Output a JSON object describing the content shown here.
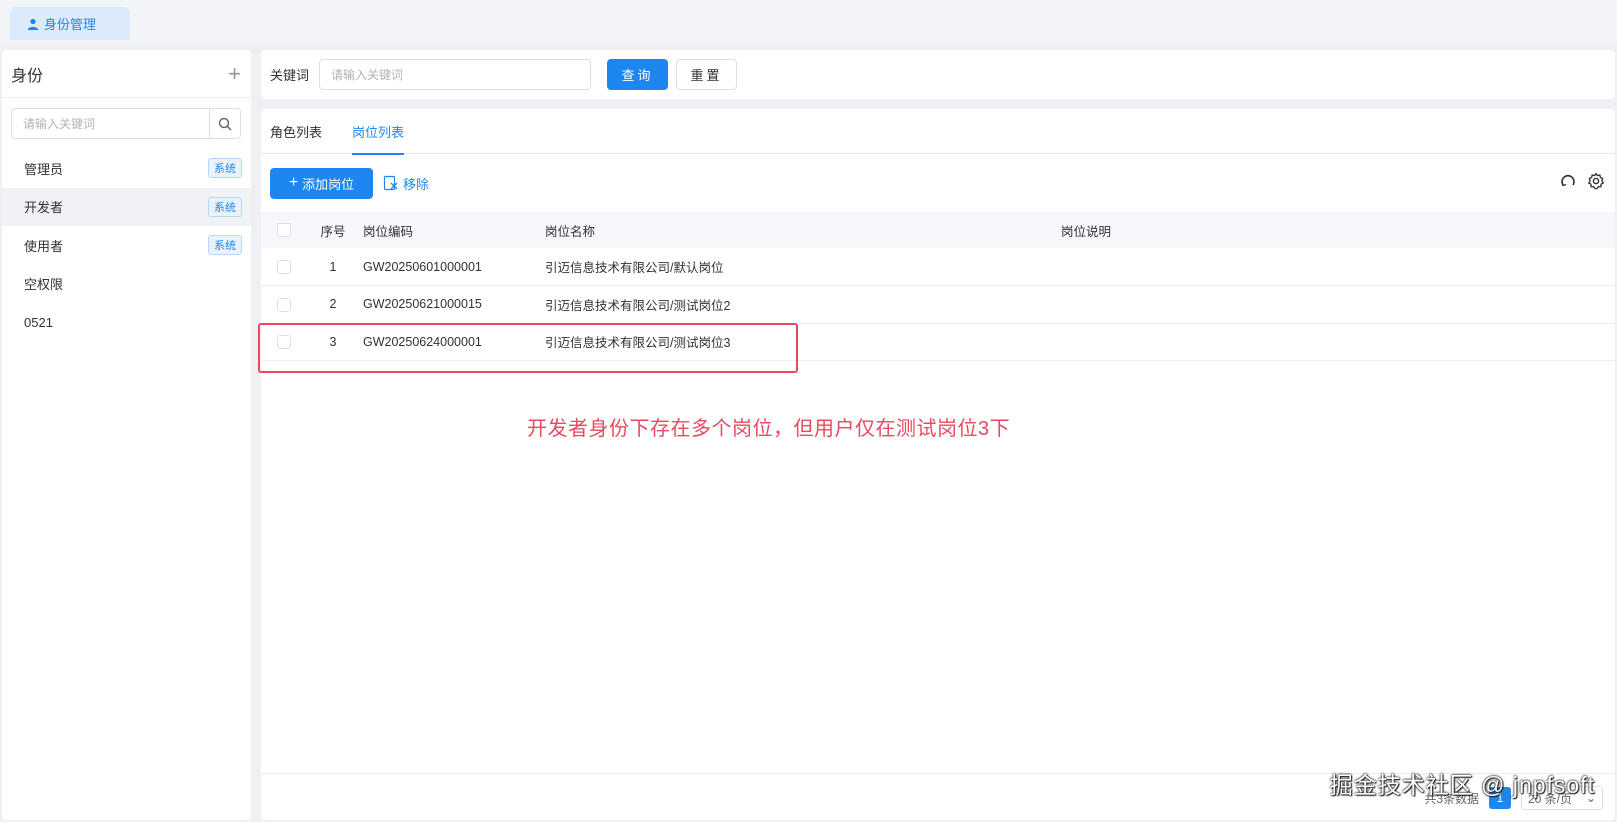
{
  "top_tab": {
    "label": "身份管理"
  },
  "sidebar": {
    "title": "身份",
    "search_placeholder": "请输入关键词",
    "items": [
      {
        "label": "管理员",
        "badge": "系统"
      },
      {
        "label": "开发者",
        "badge": "系统"
      },
      {
        "label": "使用者",
        "badge": "系统"
      },
      {
        "label": "空权限",
        "badge": ""
      },
      {
        "label": "0521",
        "badge": ""
      }
    ]
  },
  "search": {
    "label": "关键词",
    "placeholder": "请输入关键词",
    "query_label": "查询",
    "reset_label": "重置"
  },
  "tabs": [
    {
      "label": "角色列表",
      "active": false
    },
    {
      "label": "岗位列表",
      "active": true
    }
  ],
  "toolbar": {
    "add_label": "添加岗位",
    "remove_label": "移除"
  },
  "table": {
    "headers": [
      "序号",
      "岗位编码",
      "岗位名称",
      "岗位说明"
    ],
    "rows": [
      {
        "idx": "1",
        "code": "GW20250601000001",
        "name": "引迈信息技术有限公司/默认岗位",
        "desc": ""
      },
      {
        "idx": "2",
        "code": "GW20250621000015",
        "name": "引迈信息技术有限公司/测试岗位2",
        "desc": ""
      },
      {
        "idx": "3",
        "code": "GW20250624000001",
        "name": "引迈信息技术有限公司/测试岗位3",
        "desc": ""
      }
    ]
  },
  "annotation": "开发者身份下存在多个岗位，但用户仅在测试岗位3下",
  "pager": {
    "total": "共3条数据",
    "page": "1",
    "page_size": "20 条/页"
  },
  "watermark": "掘金技术社区 @ jnpfsoft",
  "colors": {
    "accent": "#1e86f0",
    "annotation": "#e84a5f"
  }
}
